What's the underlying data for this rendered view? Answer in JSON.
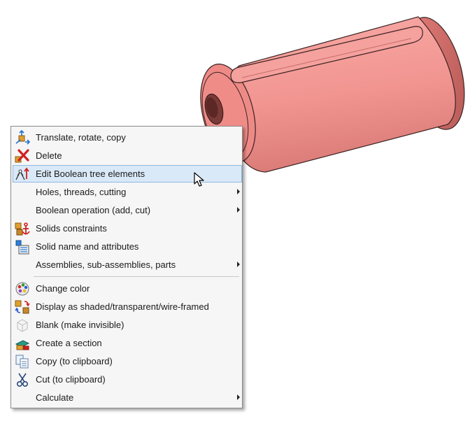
{
  "viewport": {
    "part_color": "#f4928f"
  },
  "context_menu": {
    "items": [
      {
        "label": "Translate, rotate, copy",
        "icon": "translate-icon",
        "submenu": false
      },
      {
        "label": "Delete",
        "icon": "delete-x-icon",
        "submenu": false
      },
      {
        "label": "Edit Boolean tree elements",
        "icon": "boolean-tree-icon",
        "submenu": false,
        "highlighted": true
      },
      {
        "label": "Holes, threads, cutting",
        "icon": "",
        "submenu": true
      },
      {
        "label": "Boolean operation (add, cut)",
        "icon": "",
        "submenu": true
      },
      {
        "label": "Solids constraints",
        "icon": "anchor-constraint-icon",
        "submenu": false
      },
      {
        "label": "Solid name and attributes",
        "icon": "solid-attributes-icon",
        "submenu": false
      },
      {
        "label": "Assemblies, sub-assemblies, parts",
        "icon": "",
        "submenu": true
      },
      {
        "label": "Change color",
        "icon": "color-palette-icon",
        "submenu": false
      },
      {
        "label": "Display as shaded/transparent/wire-framed",
        "icon": "display-mode-icon",
        "submenu": false
      },
      {
        "label": "Blank (make invisible)",
        "icon": "blank-cube-icon",
        "submenu": false
      },
      {
        "label": "Create a section",
        "icon": "section-icon",
        "submenu": false
      },
      {
        "label": "Copy (to clipboard)",
        "icon": "copy-icon",
        "submenu": false
      },
      {
        "label": "Cut (to clipboard)",
        "icon": "scissors-icon",
        "submenu": false
      },
      {
        "label": "Calculate",
        "icon": "",
        "submenu": true
      }
    ],
    "highlight_color": "#dae9f7"
  }
}
